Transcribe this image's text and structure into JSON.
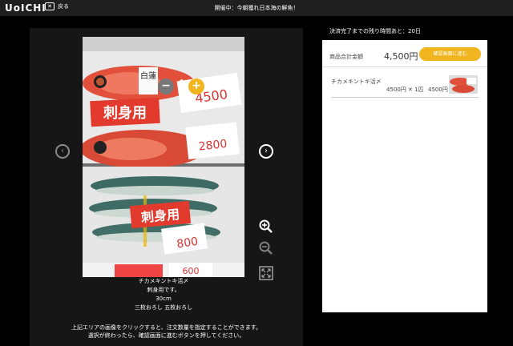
{
  "header": {
    "logo": "UoICHI",
    "back_label": "戻る",
    "title": "開催中：今朝獲れ日本海の鮮魚！"
  },
  "viewer": {
    "quantity": "1",
    "caption_lines": [
      "チカメキントキ活〆",
      "刺身用です。",
      "30cm",
      "三枚おろし 五枚おろし"
    ],
    "note_lines": [
      "上記エリアの画像をクリックすると、注文数量を指定することができます。",
      "選択が終わったら、確認画面に進むボタンを押してください。"
    ],
    "photo_labels": {
      "sashimi_top": "刺身用",
      "sashimi_bottom": "刺身用",
      "tag_white_name": "白蓮",
      "tag_price1": "4500",
      "tag_price2": "2800",
      "tag_price3": "800",
      "tag_price4": "600"
    }
  },
  "cart": {
    "remaining_text": "決済完了までの残り時間あと：20日",
    "total_label": "商品合計金額",
    "total_value": "4,500円",
    "confirm_button": "確認画面に進む",
    "items": [
      {
        "name": "チカメキントキ活〆",
        "calc": "4500円 ✕ 1匹",
        "subtotal": "4500円"
      }
    ]
  },
  "colors": {
    "accent": "#f1b520",
    "background": "#000000",
    "panel": "#ffffff"
  }
}
